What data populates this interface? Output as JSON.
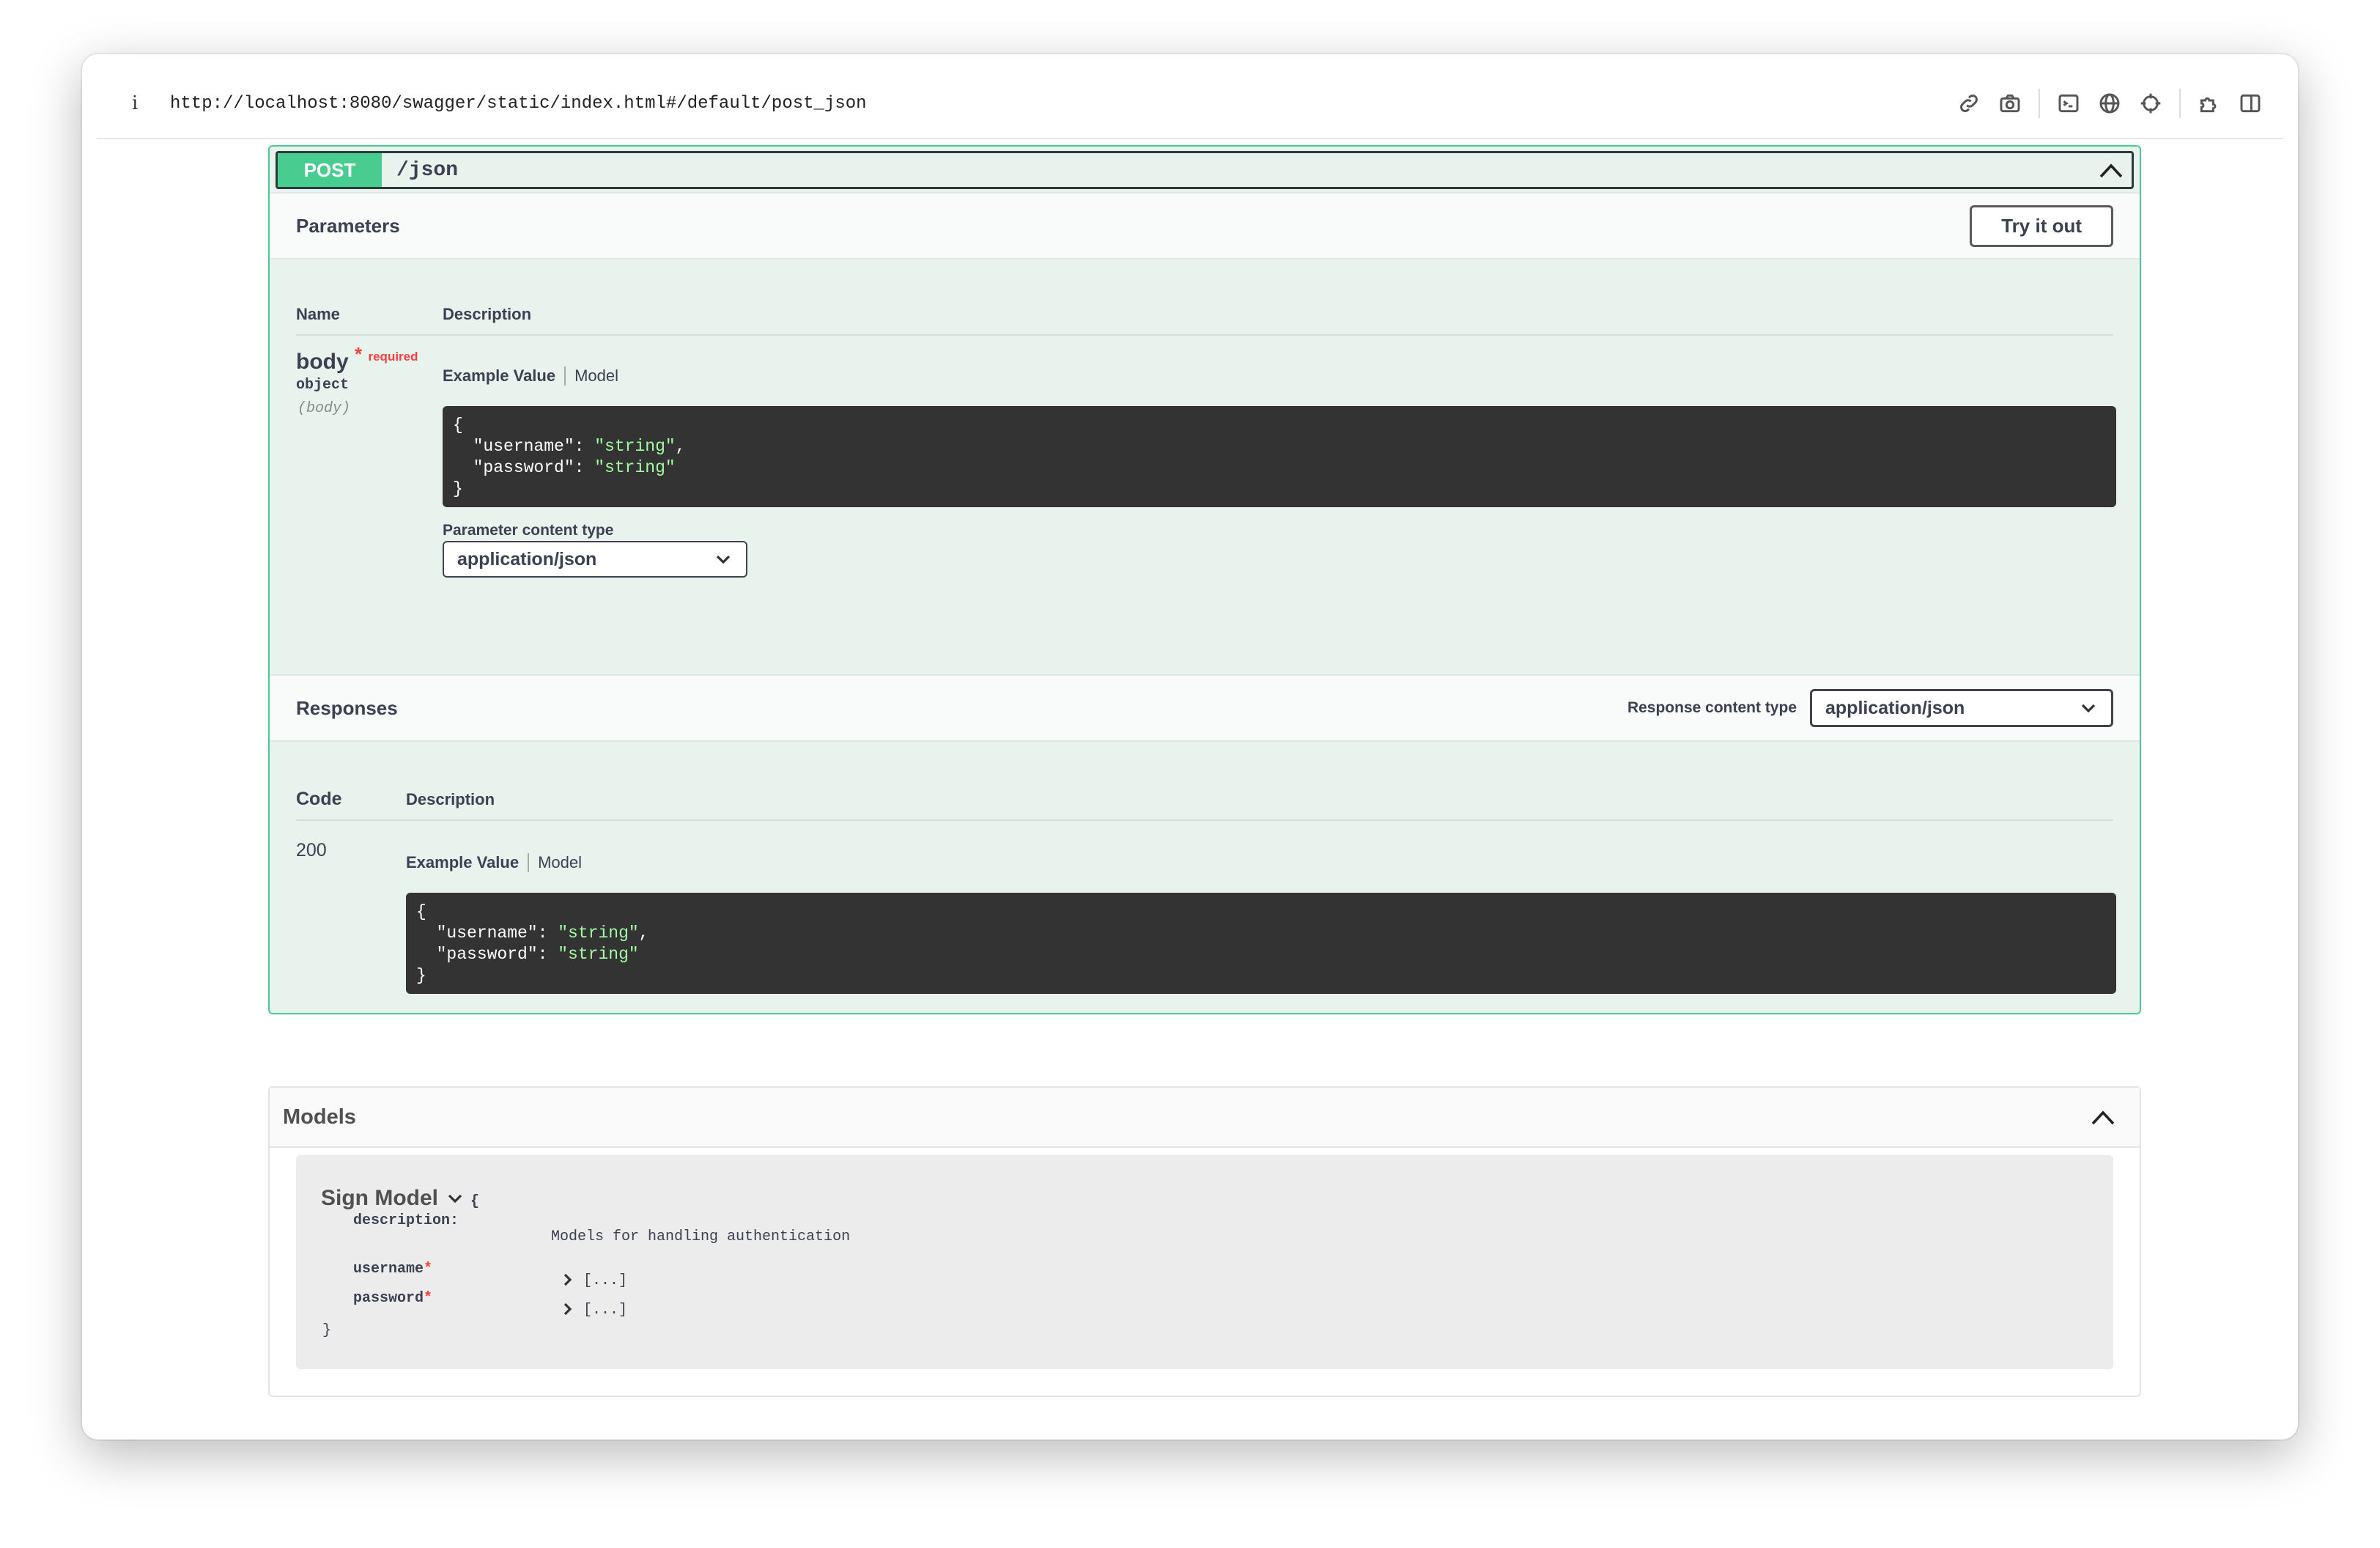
{
  "browser": {
    "info_glyph": "i",
    "url": "http://localhost:8080/swagger/static/index.html#/default/post_json",
    "tool_icons": [
      "link-icon",
      "camera-icon",
      "terminal-icon",
      "globe-icon",
      "crosshair-icon",
      "puzzle-icon",
      "sidebar-icon"
    ]
  },
  "operation": {
    "method": "POST",
    "path": "/json",
    "method_color": "#49cc90"
  },
  "parameters": {
    "title": "Parameters",
    "try_button": "Try it out",
    "col_name": "Name",
    "col_description": "Description",
    "param": {
      "name": "body",
      "star": "*",
      "required": "required",
      "type": "object",
      "in": "(body)"
    },
    "tabs": {
      "example": "Example Value",
      "model": "Model"
    },
    "example": {
      "open": "{",
      "k1": "\"username\"",
      "v1": "\"string\"",
      "k2": "\"password\"",
      "v2": "\"string\"",
      "close": "}"
    },
    "content_type_label": "Parameter content type",
    "content_type_value": "application/json"
  },
  "responses": {
    "title": "Responses",
    "content_type_label": "Response content type",
    "content_type_value": "application/json",
    "col_code": "Code",
    "col_description": "Description",
    "code": "200",
    "tabs": {
      "example": "Example Value",
      "model": "Model"
    },
    "example": {
      "open": "{",
      "k1": "\"username\"",
      "v1": "\"string\"",
      "k2": "\"password\"",
      "v2": "\"string\"",
      "close": "}"
    }
  },
  "models": {
    "title": "Models",
    "model_name": "Sign Model",
    "brace_open": "{",
    "description_label": "description:",
    "description_value": "Models for handling authentication",
    "props": [
      {
        "name": "username",
        "star": "*",
        "value": "[...]"
      },
      {
        "name": "password",
        "star": "*",
        "value": "[...]"
      }
    ],
    "brace_close": "}"
  }
}
